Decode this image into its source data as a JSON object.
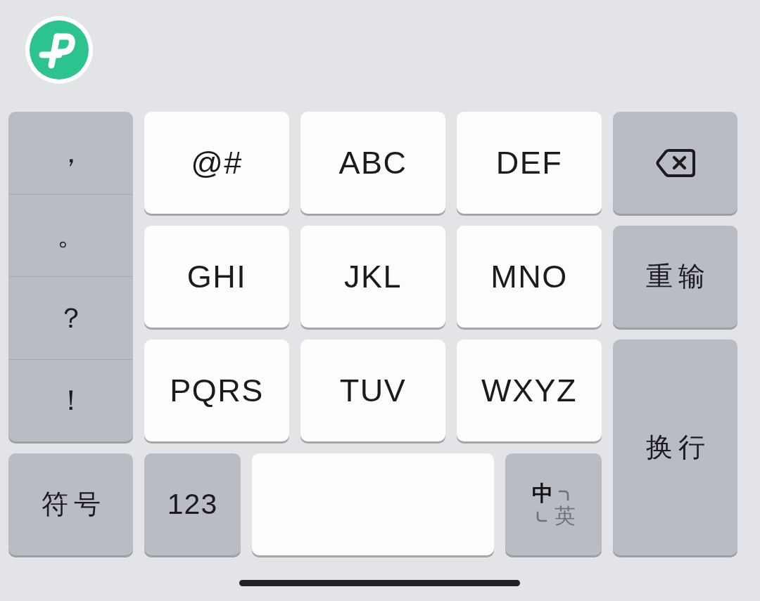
{
  "keyboard": {
    "punctuation": [
      "，",
      "。",
      "？",
      "！"
    ],
    "letter_rows": [
      [
        "@#",
        "ABC",
        "DEF"
      ],
      [
        "GHI",
        "JKL",
        "MNO"
      ],
      [
        "PQRS",
        "TUV",
        "WXYZ"
      ]
    ],
    "reset_key": "重输",
    "enter_key": "换行",
    "symbol_key": "符号",
    "number_key": "123",
    "language_toggle": [
      {
        "label": "中",
        "selected": true
      },
      {
        "label": "英",
        "selected": false
      }
    ]
  }
}
